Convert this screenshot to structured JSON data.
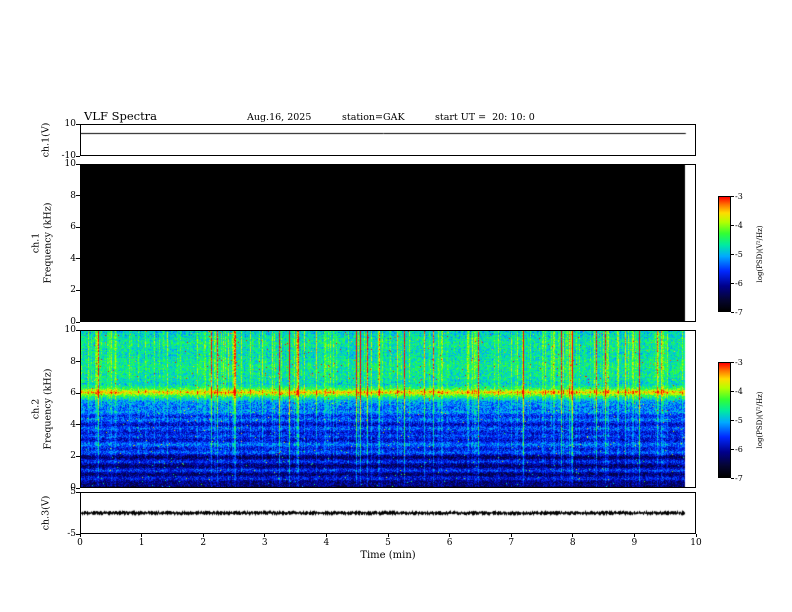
{
  "title": "VLF Spectra",
  "header": {
    "date": "Aug.16, 2025",
    "station": "station=GAK",
    "start_ut": "start UT =  20: 10: 0"
  },
  "xaxis": {
    "label": "Time (min)",
    "range": [
      0,
      10
    ],
    "ticks": [
      0,
      1,
      2,
      3,
      4,
      5,
      6,
      7,
      8,
      9,
      10
    ],
    "data_extent_min": 9.85
  },
  "colorbar": {
    "label": "log(PSD)(V²/Hz)",
    "ticks": [
      -3,
      -4,
      -5,
      -6,
      -7
    ],
    "max": -3,
    "min": -7
  },
  "colors": {
    "background": "#ffffff",
    "axis": "#000000"
  },
  "colormap_stops": [
    [
      0.0,
      [
        0,
        0,
        0
      ]
    ],
    [
      0.1,
      [
        5,
        5,
        50
      ]
    ],
    [
      0.22,
      [
        0,
        0,
        140
      ]
    ],
    [
      0.35,
      [
        0,
        40,
        255
      ]
    ],
    [
      0.48,
      [
        0,
        170,
        255
      ]
    ],
    [
      0.58,
      [
        0,
        235,
        160
      ]
    ],
    [
      0.68,
      [
        50,
        255,
        50
      ]
    ],
    [
      0.78,
      [
        180,
        255,
        0
      ]
    ],
    [
      0.86,
      [
        255,
        220,
        0
      ]
    ],
    [
      0.93,
      [
        255,
        120,
        0
      ]
    ],
    [
      1.0,
      [
        255,
        0,
        0
      ]
    ]
  ],
  "seed": 1337,
  "chart_data": [
    {
      "id": "ch1-voltage",
      "type": "line",
      "ylabel": "ch.1(V)",
      "ylim": [
        -10,
        10
      ],
      "yticks": [
        10,
        -10
      ],
      "flat_value": 4.4,
      "description": "constant flat trace across the full record"
    },
    {
      "id": "ch1-spectrogram",
      "type": "heatmap",
      "ylabel_line1": "ch.1",
      "ylabel_line2": "Frequency (kHz)",
      "ylim": [
        0,
        10
      ],
      "yticks": [
        10,
        8,
        6,
        4,
        2,
        0
      ],
      "psd_range": [
        -7,
        -3
      ],
      "description": "entire panel at/below the -7 log(PSD) floor - rendered solid black (no signal on ch.1)"
    },
    {
      "id": "ch2-spectrogram",
      "type": "heatmap",
      "ylabel_line1": "ch.2",
      "ylabel_line2": "Frequency (kHz)",
      "ylim": [
        0,
        10
      ],
      "yticks": [
        10,
        8,
        6,
        4,
        2,
        0
      ],
      "psd_range": [
        -7,
        -3
      ],
      "description": "broadband VLF noise: dark-blue banded PSD below 5 kHz with horizontal interference lines, bright yellow-orange band near 6.1 kHz, green-cyan diffuse noise 6.5-10 kHz, dense vertical sferic streaks (some reaching red) across the whole record",
      "model": {
        "profile": [
          [
            0.0,
            0.1
          ],
          [
            0.25,
            0.18
          ],
          [
            0.5,
            0.3
          ],
          [
            0.8,
            0.16
          ],
          [
            1.05,
            0.34
          ],
          [
            1.3,
            0.16
          ],
          [
            1.6,
            0.3
          ],
          [
            1.9,
            0.18
          ],
          [
            2.2,
            0.32
          ],
          [
            2.8,
            0.36
          ],
          [
            3.2,
            0.28
          ],
          [
            3.6,
            0.34
          ],
          [
            4.0,
            0.3
          ],
          [
            4.5,
            0.36
          ],
          [
            5.0,
            0.4
          ],
          [
            5.5,
            0.44
          ],
          [
            5.85,
            0.62
          ],
          [
            6.1,
            0.84
          ],
          [
            6.35,
            0.62
          ],
          [
            6.6,
            0.52
          ],
          [
            7.0,
            0.55
          ],
          [
            7.8,
            0.57
          ],
          [
            8.6,
            0.53
          ],
          [
            9.3,
            0.56
          ],
          [
            10.0,
            0.5
          ]
        ],
        "ripple_amp": 0.05,
        "ripple_freq": 12,
        "noise_amp": 0.22,
        "streak_strong_prob": 0.05,
        "streak_medium_prob": 0.28,
        "impulse_prob": 0.006
      }
    },
    {
      "id": "ch3-voltage",
      "type": "line",
      "ylabel": "ch.3(V)",
      "ylim": [
        -5,
        5
      ],
      "yticks": [
        5,
        -5
      ],
      "mean": 0,
      "noise_amplitude": 0.5,
      "description": "dense low-amplitude noise band centered on 0 V"
    }
  ]
}
